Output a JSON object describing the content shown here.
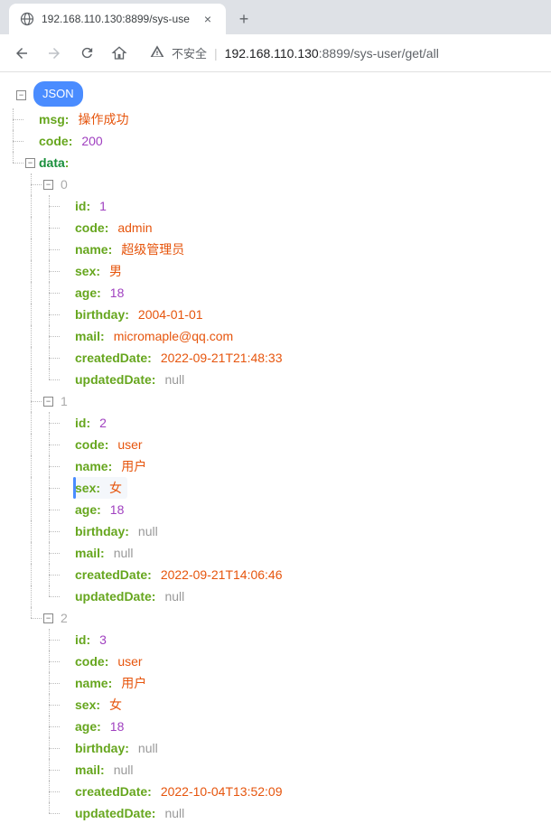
{
  "browser": {
    "tab_title": "192.168.110.130:8899/sys-use",
    "insecure_label": "不安全",
    "url_host": "192.168.110.130",
    "url_port": ":8899",
    "url_path": "/sys-user/get/all"
  },
  "json_badge": "JSON",
  "tree": {
    "msg_key": "msg",
    "msg_val": "操作成功",
    "code_key": "code",
    "code_val": "200",
    "data_key": "data",
    "indices": [
      "0",
      "1",
      "2"
    ],
    "fields": {
      "id": "id",
      "code": "code",
      "name": "name",
      "sex": "sex",
      "age": "age",
      "birthday": "birthday",
      "mail": "mail",
      "createdDate": "createdDate",
      "updatedDate": "updatedDate"
    },
    "items": [
      {
        "id": "1",
        "code": "admin",
        "name": "超级管理员",
        "sex": "男",
        "age": "18",
        "birthday": "2004-01-01",
        "mail": "micromaple@qq.com",
        "createdDate": "2022-09-21T21:48:33",
        "updatedDate": "null"
      },
      {
        "id": "2",
        "code": "user",
        "name": "用户",
        "sex": "女",
        "age": "18",
        "birthday": "null",
        "mail": "null",
        "createdDate": "2022-09-21T14:06:46",
        "updatedDate": "null"
      },
      {
        "id": "3",
        "code": "user",
        "name": "用户",
        "sex": "女",
        "age": "18",
        "birthday": "null",
        "mail": "null",
        "createdDate": "2022-10-04T13:52:09",
        "updatedDate": "null"
      }
    ]
  }
}
